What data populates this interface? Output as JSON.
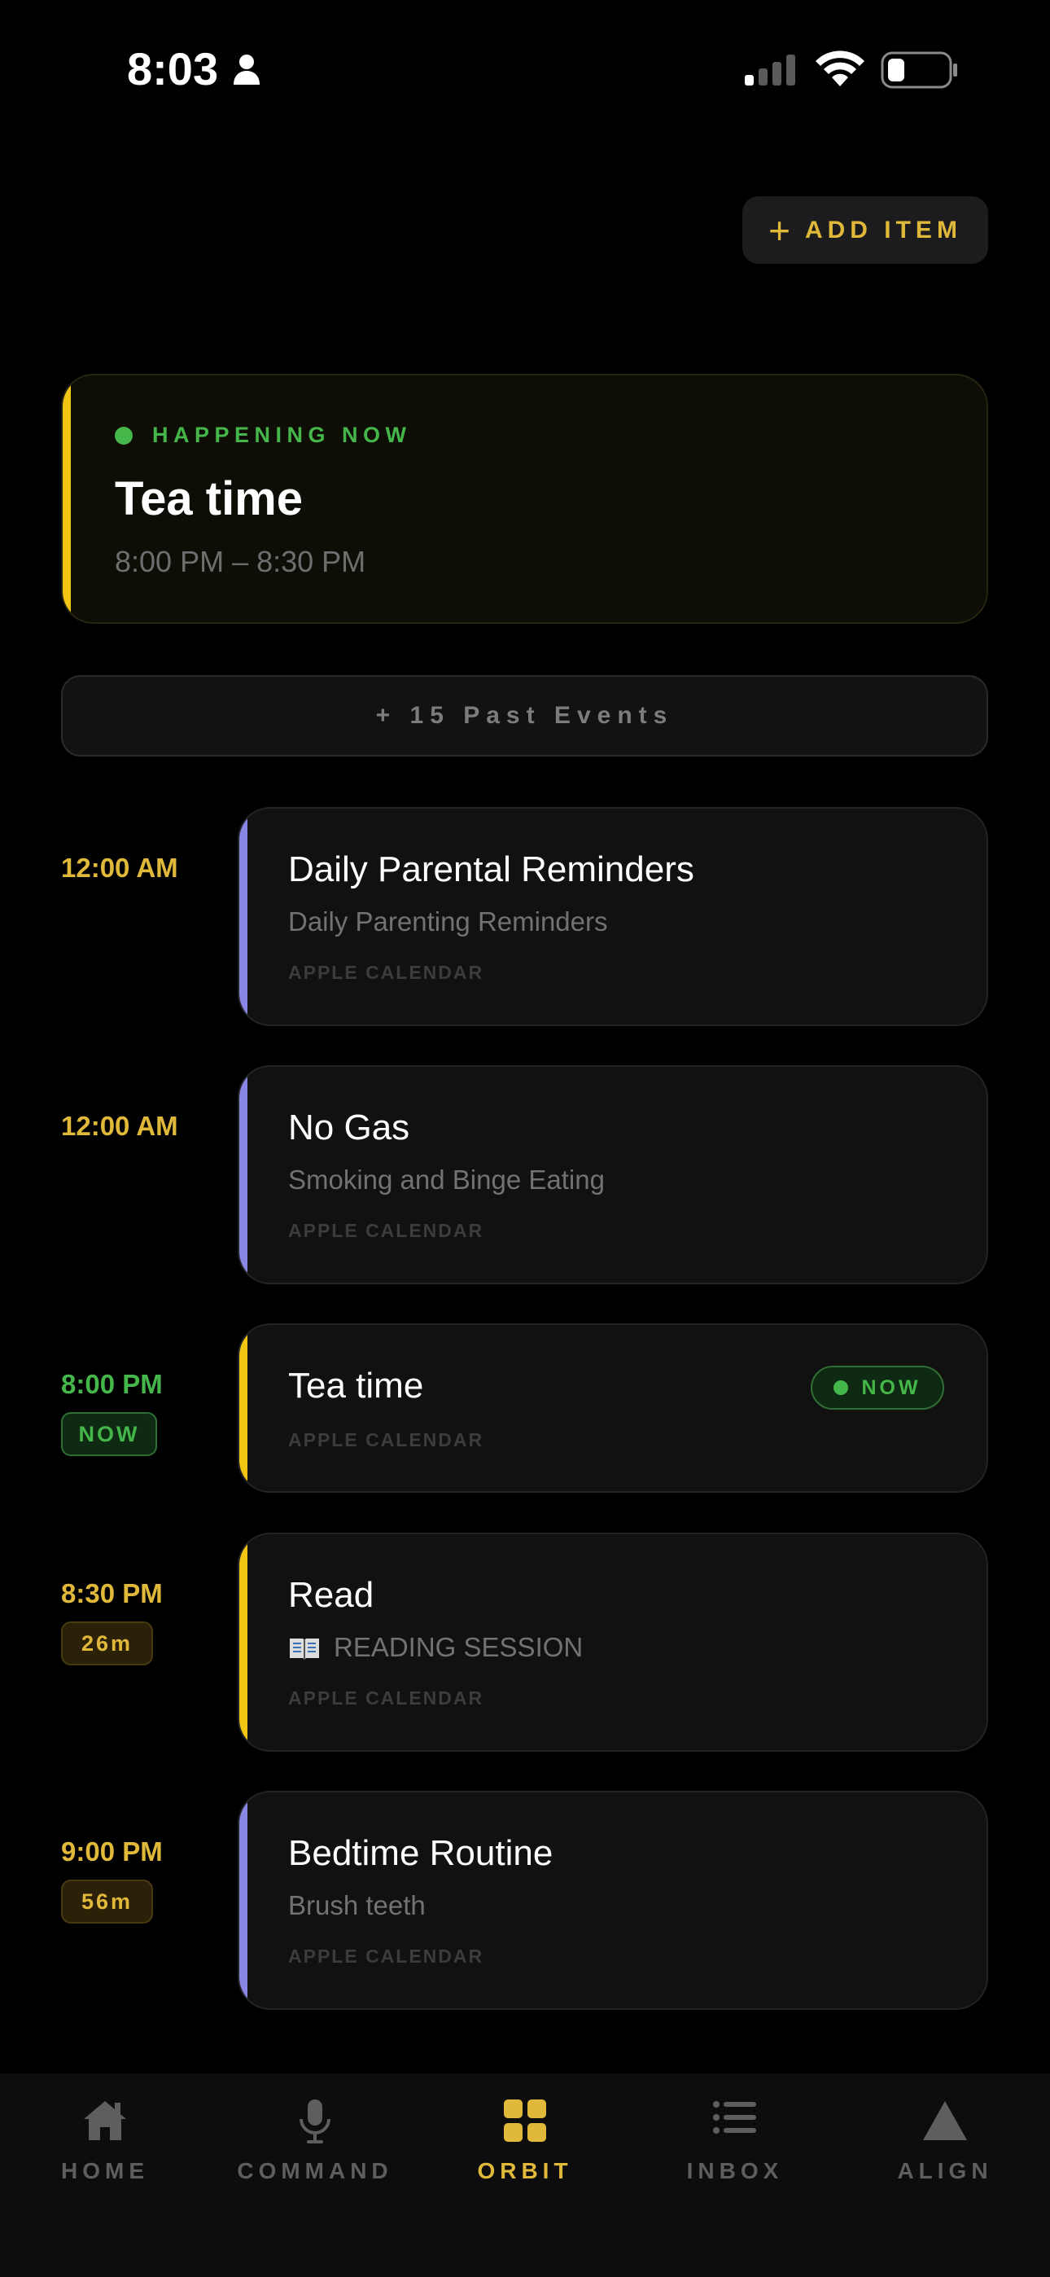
{
  "status_bar": {
    "time": "8:03"
  },
  "header": {
    "add_item_label": "ADD ITEM"
  },
  "happening_now": {
    "label": "HAPPENING NOW",
    "title": "Tea time",
    "time_range": "8:00 PM – 8:30 PM"
  },
  "past_events": {
    "label": "+ 15 Past Events"
  },
  "timeline": [
    {
      "time": "12:00 AM",
      "title": "Daily Parental Reminders",
      "subtitle": "Daily Parenting Reminders",
      "source": "APPLE CALENDAR",
      "accent": "#8a86e6"
    },
    {
      "time": "12:00 AM",
      "title": "No Gas",
      "subtitle": "Smoking and Binge Eating",
      "source": "APPLE CALENDAR",
      "accent": "#8a86e6"
    },
    {
      "time": "8:00 PM",
      "chip": "NOW",
      "title": "Tea time",
      "badge": "NOW",
      "source": "APPLE CALENDAR",
      "accent": "#f2c515"
    },
    {
      "time": "8:30 PM",
      "chip": "26m",
      "title": "Read",
      "subtitle": "READING SESSION",
      "source": "APPLE CALENDAR",
      "accent": "#f2c515"
    },
    {
      "time": "9:00 PM",
      "chip": "56m",
      "title": "Bedtime Routine",
      "subtitle": "Brush teeth",
      "source": "APPLE CALENDAR",
      "accent": "#8a86e6"
    }
  ],
  "tab_bar": {
    "tabs": [
      {
        "label": "HOME",
        "icon": "house-icon"
      },
      {
        "label": "COMMAND",
        "icon": "microphone-icon"
      },
      {
        "label": "ORBIT",
        "icon": "grid-icon",
        "active": true
      },
      {
        "label": "INBOX",
        "icon": "list-icon"
      },
      {
        "label": "ALIGN",
        "icon": "triangle-icon"
      }
    ]
  },
  "colors": {
    "accent_gold": "#e0b83a",
    "now_green": "#45b649",
    "calendar_purple": "#8a86e6",
    "event_yellow": "#f2c515"
  }
}
